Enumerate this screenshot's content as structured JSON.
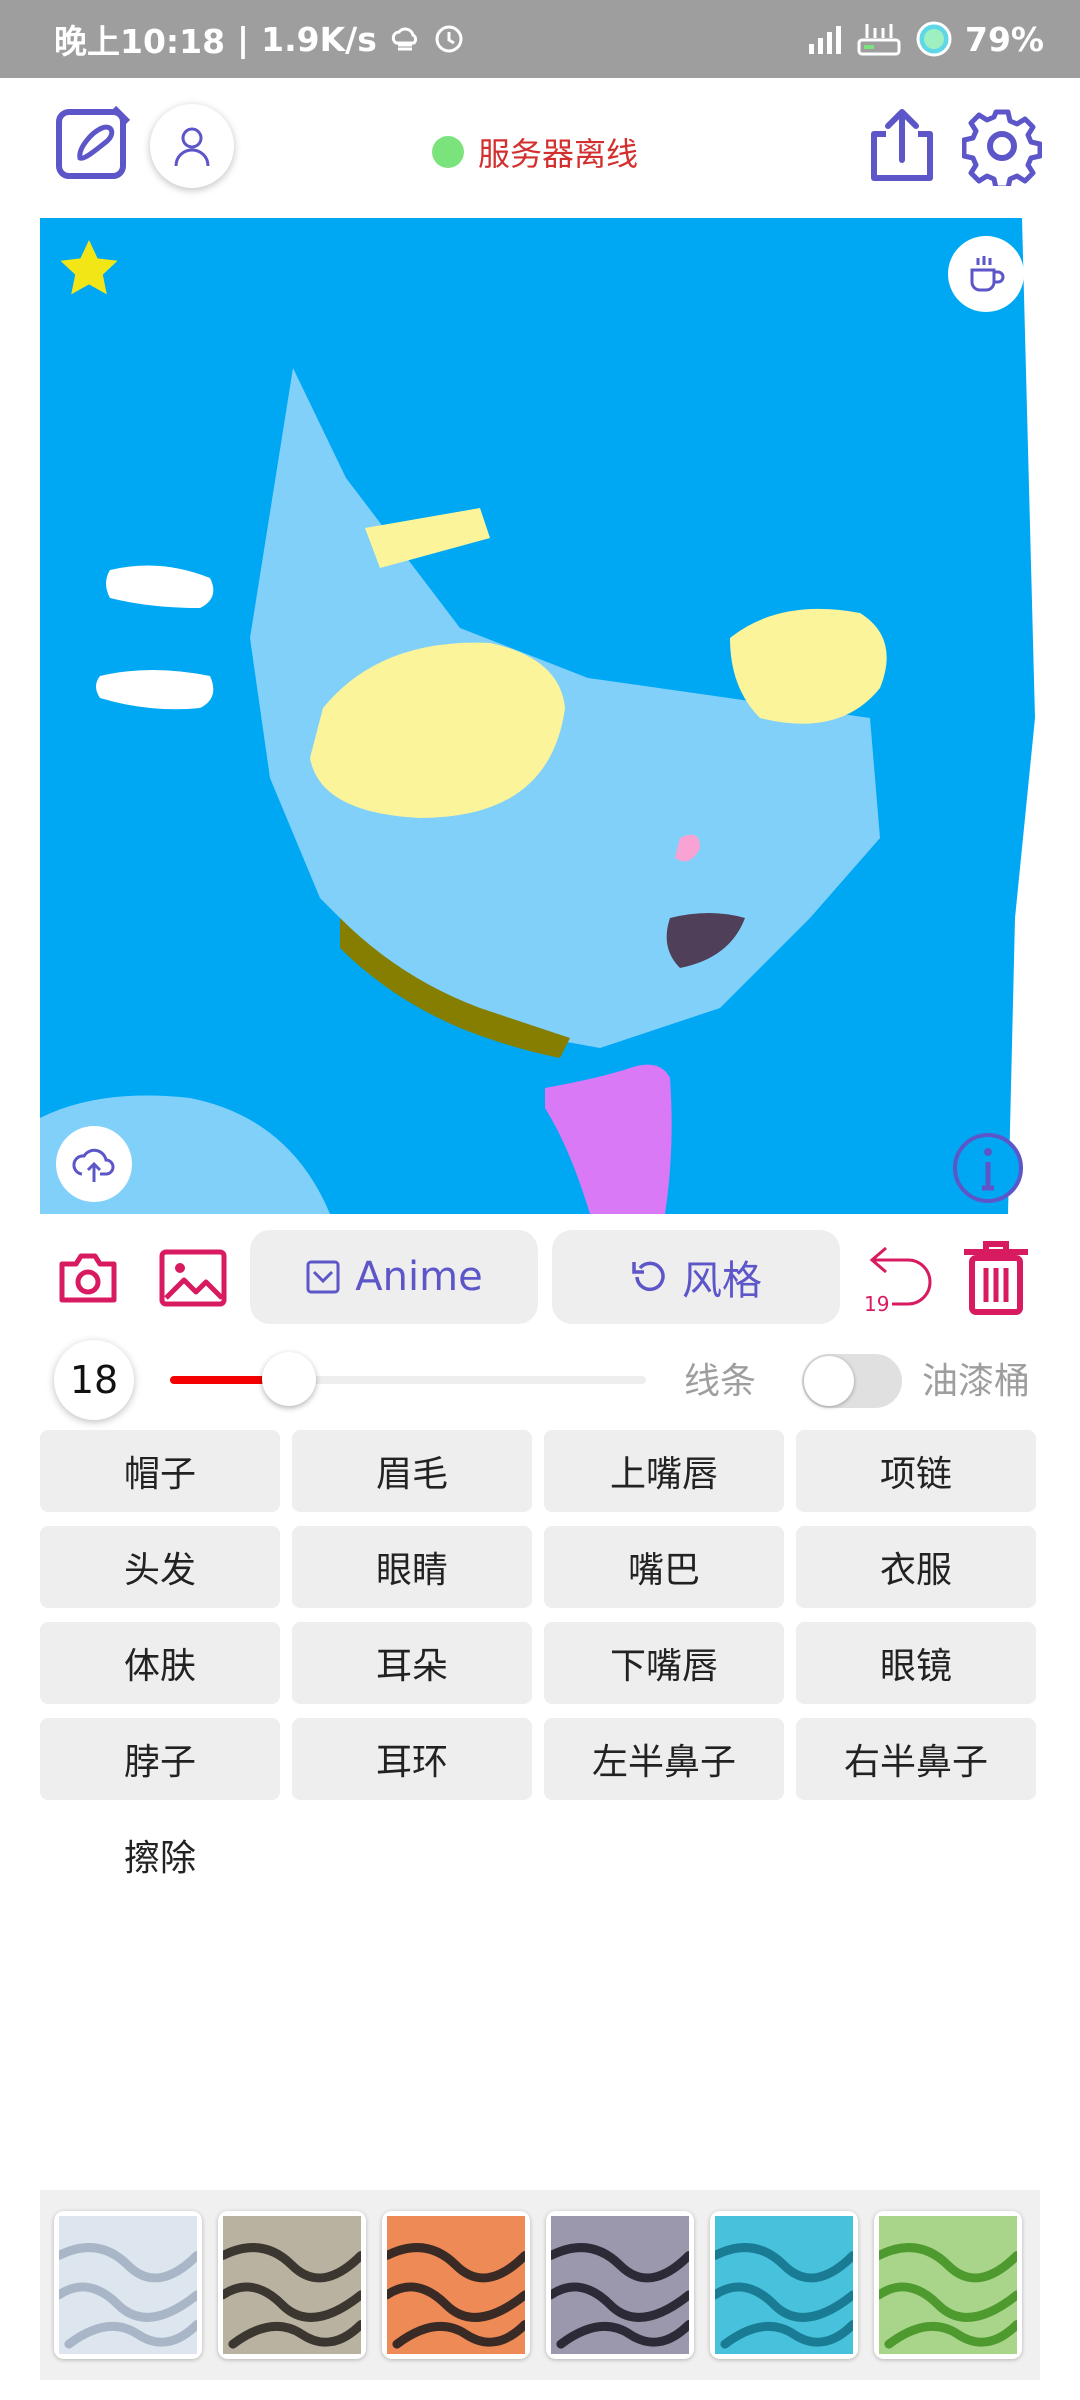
{
  "status_bar": {
    "time": "晚上10:18",
    "separator": "|",
    "speed": "1.9K/s",
    "battery": "79%"
  },
  "app_bar": {
    "server_status": "服务器离线",
    "server_status_color": "#d32f2f",
    "indicator_color": "#7be37b"
  },
  "canvas": {
    "background": "#00a8f4"
  },
  "toolbar": {
    "anime_label": "Anime",
    "style_label": "风格",
    "undo_count": "19"
  },
  "brush": {
    "size": "18",
    "slider_level": 0.25,
    "line_label": "线条",
    "bucket_label": "油漆桶",
    "bucket_enabled": false,
    "accent": "#f30000"
  },
  "parts": [
    "帽子",
    "眉毛",
    "上嘴唇",
    "项链",
    "头发",
    "眼睛",
    "嘴巴",
    "衣服",
    "体肤",
    "耳朵",
    "下嘴唇",
    "眼镜",
    "脖子",
    "耳环",
    "左半鼻子",
    "右半鼻子",
    "擦除"
  ],
  "style_thumbnails": [
    {
      "name": "white-style",
      "color": "#dde6ee",
      "stroke": "#a8b6c8"
    },
    {
      "name": "grey-style",
      "color": "#b9b2a0",
      "stroke": "#3b3730"
    },
    {
      "name": "orange-style",
      "color": "#ee8a55",
      "stroke": "#3a2a25"
    },
    {
      "name": "slate-style",
      "color": "#9b97ad",
      "stroke": "#2c2a36"
    },
    {
      "name": "cyan-style",
      "color": "#47c1dc",
      "stroke": "#1a7c94"
    },
    {
      "name": "green-style",
      "color": "#a8d58a",
      "stroke": "#4f9a2f"
    }
  ]
}
